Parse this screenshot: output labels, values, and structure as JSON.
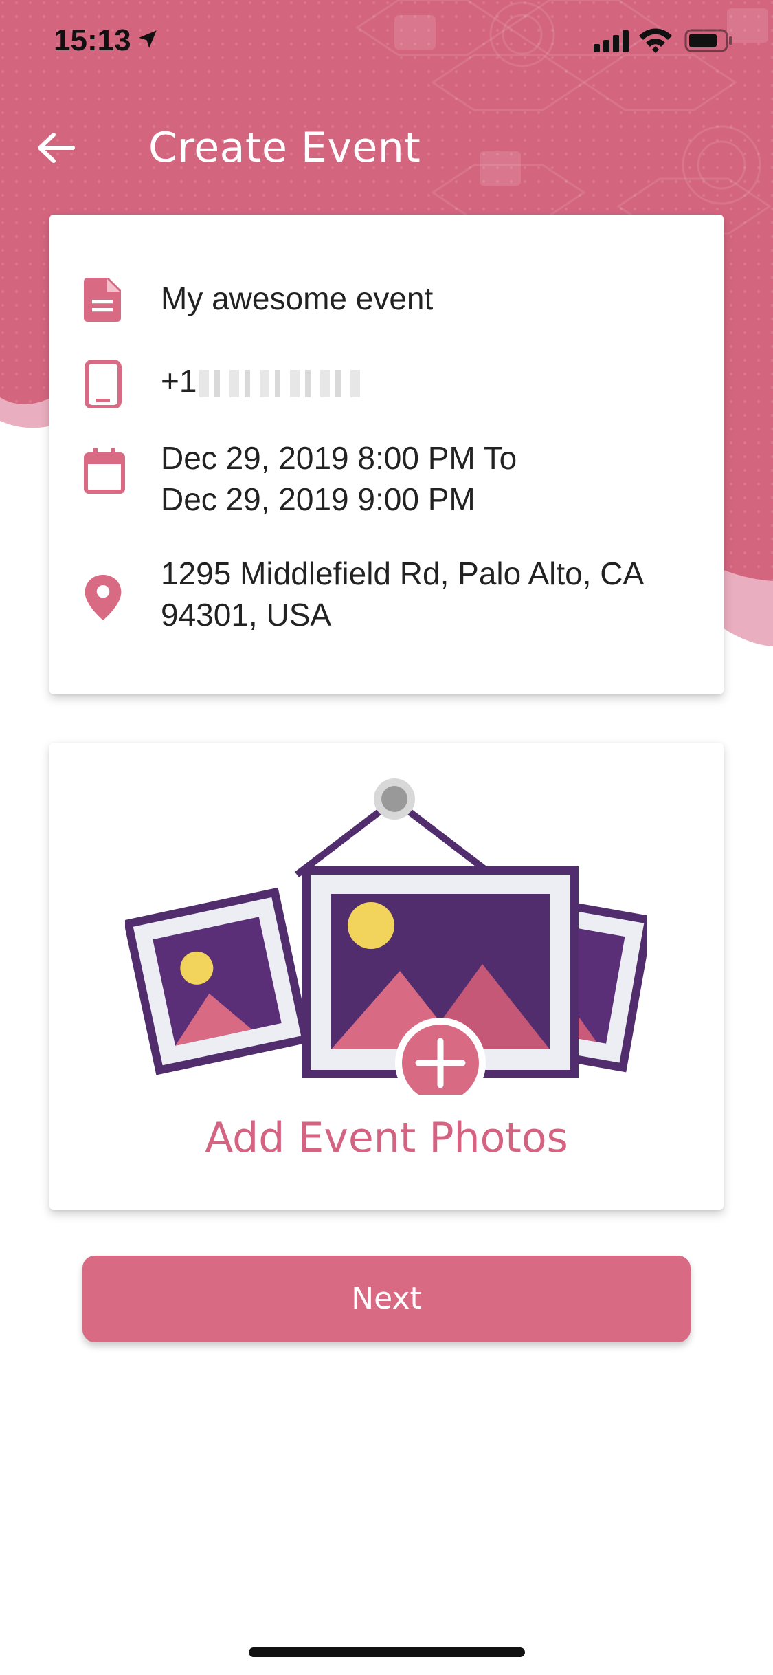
{
  "status_bar": {
    "time": "15:13",
    "icons": [
      "location-arrow-icon",
      "signal-icon",
      "wifi-icon",
      "battery-icon"
    ]
  },
  "header": {
    "title": "Create Event",
    "back_icon": "arrow-left-icon"
  },
  "event_details": {
    "name": "My awesome event",
    "phone_prefix": "+1",
    "date_line1": "Dec 29, 2019  8:00 PM To",
    "date_line2": "Dec 29, 2019  9:00 PM",
    "address_line1": "1295 Middlefield Rd, Palo Alto, CA",
    "address_line2": "94301, USA",
    "icons": [
      "document-icon",
      "phone-icon",
      "calendar-icon",
      "map-pin-icon"
    ]
  },
  "photos": {
    "label": "Add Event Photos",
    "icon": "add-photo-frames-icon"
  },
  "actions": {
    "next_label": "Next"
  },
  "colors": {
    "accent": "#d96a84",
    "accent_text": "#d46381",
    "header_bg": "#d4657f",
    "illustration_purple": "#512d6d",
    "illustration_yellow": "#f2d35b"
  }
}
